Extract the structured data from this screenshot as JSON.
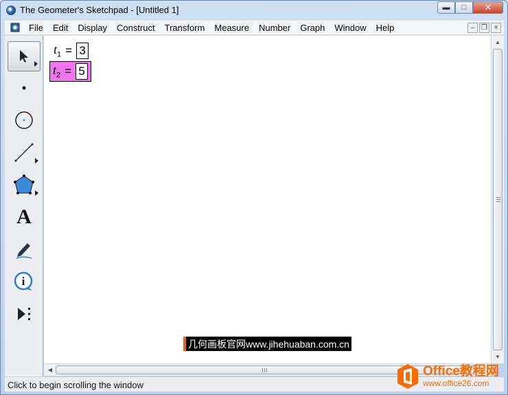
{
  "window": {
    "title": "The Geometer's Sketchpad - [Untitled 1]",
    "caption_buttons": {
      "minimize": "▬",
      "maximize": "□",
      "close": "✕"
    },
    "mdi_buttons": {
      "minimize": "–",
      "restore": "❐",
      "close": "×"
    }
  },
  "menu": [
    "File",
    "Edit",
    "Display",
    "Construct",
    "Transform",
    "Measure",
    "Number",
    "Graph",
    "Window",
    "Help"
  ],
  "toolbox": [
    {
      "name": "selection-arrow-tool",
      "icon": "arrow-cursor-icon",
      "selected": true
    },
    {
      "name": "point-tool",
      "icon": "point-icon"
    },
    {
      "name": "compass-tool",
      "icon": "compass-circle-icon"
    },
    {
      "name": "straightedge-tool",
      "icon": "segment-icon"
    },
    {
      "name": "polygon-tool",
      "icon": "pentagon-icon"
    },
    {
      "name": "text-tool",
      "icon": "text-A-icon",
      "glyph": "A"
    },
    {
      "name": "marker-tool",
      "icon": "marker-pen-icon"
    },
    {
      "name": "information-tool",
      "icon": "info-icon",
      "glyph": "i"
    },
    {
      "name": "custom-tool",
      "icon": "custom-tools-icon"
    }
  ],
  "parameters": [
    {
      "label": "t",
      "subscript": "1",
      "equals": "=",
      "value": "3",
      "selected": false
    },
    {
      "label": "t",
      "subscript": "2",
      "equals": "=",
      "value": "5",
      "selected": true,
      "highlight_color": "#ee77ee"
    }
  ],
  "watermark": "几何画板官网www.jihehuaban.com.cn",
  "status": "Click to begin scrolling the window",
  "logo": {
    "main": "Office教程网",
    "url": "www.office26.com",
    "color": "#ff6a00"
  },
  "colors": {
    "selection_highlight": "#ee77ee",
    "polygon_fill": "#3b8ad8"
  }
}
